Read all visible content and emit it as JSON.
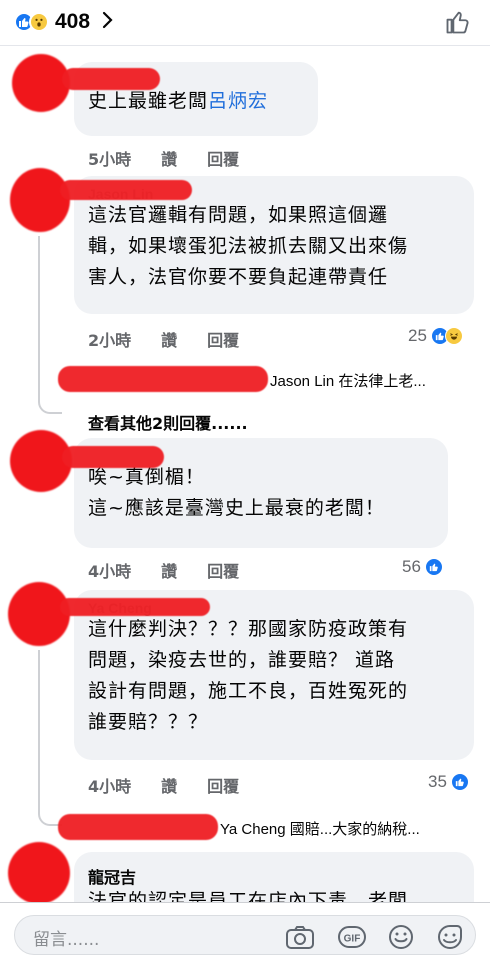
{
  "header": {
    "reaction_count": "408"
  },
  "comments": [
    {
      "text_parts": [
        "史上最雖老闆",
        "呂炳宏"
      ],
      "time": "5小時",
      "like": "讚",
      "reply": "回覆"
    },
    {
      "name": "Jason Lin",
      "lines": [
        "這法官邏輯有問題，如果照這個邏",
        "輯，如果壞蛋犯法被抓去關又出來傷",
        "害人，法官你要不要負起連帶責任"
      ],
      "time": "2小時",
      "like": "讚",
      "reply": "回覆",
      "reactions": "25",
      "reply_preview": "Jason Lin 在法律上老...",
      "more_replies": "查看其他2則回覆......"
    },
    {
      "lines": [
        "唉~真倒楣！",
        "這~應該是臺灣史上最衰的老闆！"
      ],
      "time": "4小時",
      "like": "讚",
      "reply": "回覆",
      "reactions": "56"
    },
    {
      "name": "Ya Cheng",
      "lines": [
        "這什麼判決？？？那國家防疫政策有",
        "問題，染疫去世的，誰要賠？ 道路",
        "設計有問題，施工不良，百姓冤死的",
        "誰要賠？？？"
      ],
      "time": "4小時",
      "like": "讚",
      "reply": "回覆",
      "reactions": "35",
      "reply_preview": "Ya Cheng 國賠...大家的納稅..."
    },
    {
      "name": "龍冠吉",
      "partial_line": "法官的認定是員工在店內下毒，老闆"
    }
  ],
  "composer": {
    "placeholder": "留言......"
  },
  "icons": [
    "like-reaction-icon",
    "wow-reaction-icon",
    "chevron-right-icon",
    "thumbs-up-icon",
    "haha-reaction-icon",
    "camera-icon",
    "gif-icon",
    "emoji-icon",
    "sticker-icon"
  ],
  "colors": {
    "accent": "#1877f2",
    "redaction": "#ef1e23",
    "bubble": "#f0f2f5"
  }
}
